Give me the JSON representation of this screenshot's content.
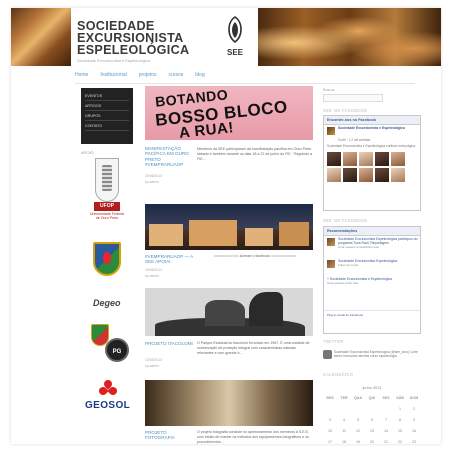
{
  "site": {
    "title_lines": [
      "SOCIEDADE",
      "EXCURSIONISTA",
      "ESPELEOLÓGICA"
    ],
    "tagline": "Sociedade Excursionista e Espeleológica",
    "logo_text": "SEE"
  },
  "nav": [
    "Home",
    "Institucional",
    "projetos",
    "cursos",
    "blog"
  ],
  "left_menu": [
    "EVENTOS",
    "ARTIGOS",
    "GRUPOS",
    "CONTATO"
  ],
  "apoio_label": "APOIO",
  "partners": {
    "ufop_tag": "UFOP",
    "ufop_name_1": "Universidade Federal",
    "ufop_name_2": "de Ouro Preto",
    "degeo": "Degeo",
    "pg": "PG",
    "geosol": "GEOSOL"
  },
  "graffiti": [
    "BOTANDO",
    "BOSSO BLOCO",
    "A RUA!"
  ],
  "posts": [
    {
      "title": "MANIFESTAÇÃO PACÍFICA EM OURO PRETO #VEMPRARUAOP",
      "date": "20/06/2013",
      "author": "by admin",
      "excerpt": "Membros da SEE participaram da manifestação pacífica em Ouro Preto sábado e também durante os dias 18 a 22 de junho do FIE. \"Seguindo a FIE..."
    },
    {
      "title": "#VEMPRARUAOP — A SEE APOIA!",
      "date": "19/06/2013",
      "author": "by admin",
      "excerpt": "============ Acesse o facebook ============"
    },
    {
      "title": "PROJETO ITACOLOMI",
      "date": "13/05/2013",
      "author": "by admin",
      "excerpt": "O Parque Estadual do Itacolomi foi criado em 1967. É uma unidade de conservação de proteção integral com características naturais relevantes e com grande b..."
    },
    {
      "title": "PROJETO FOTOGRAFIA",
      "date": "06/05/2013",
      "author": "by admin",
      "excerpt": "O projeto fotografia consiste no aprimoramento dos membros à S.E.E. com intuito de manter os métodos dos equipamentos fotográficos e os procedimentos..."
    }
  ],
  "sidebar": {
    "search_label": "Buscar",
    "search_placeholder": "",
    "head_facebook": "SEE NO FACEBOOK",
    "fb_title": "Encontre-nos no Facebook",
    "fb_page": "Sociedade Excursionista e Espeleológica",
    "fb_like": "Curtir · 1.2 mil curtidas",
    "fb_text": "Sociedade Excursionista e Espeleológica curtiram esta página.",
    "head_facebook2": "SEE NO FACEBOOK",
    "rec_title": "Recomendações",
    "rec_items": [
      {
        "title": "Sociedade Excursionista Espeleológica participou do programa Toca Raul, Reportagem",
        "sub": "Uma pessoa compartilhou isso."
      },
      {
        "title": "Sociedade Excursionista Espeleológica",
        "sub": "Fotos do mural"
      },
      {
        "title": "+ Sociedade Excursionista e Espeleológica",
        "sub": "Uma pessoa curtiu isso."
      }
    ],
    "fb_plugin": "Plug-in social do Facebook",
    "head_twitter": "TWITTER",
    "tweet": "Sociedade Excursionista Espeleológica (@see_ouro) Corte tweet: Inscrições abertas curso espeleologia",
    "head_calendar": "CALENDÁRIO",
    "calendar_month": "junho 2013",
    "calendar_days": [
      "SEG",
      "TER",
      "QUA",
      "QUI",
      "SEX",
      "SÁB",
      "DOM"
    ],
    "calendar_rows": [
      [
        "",
        "",
        "",
        "",
        "",
        "1",
        "2"
      ],
      [
        "3",
        "4",
        "5",
        "6",
        "7",
        "8",
        "9"
      ],
      [
        "10",
        "11",
        "12",
        "13",
        "14",
        "15",
        "16"
      ],
      [
        "17",
        "18",
        "19",
        "20",
        "21",
        "22",
        "23"
      ],
      [
        "24",
        "25",
        "26",
        "27",
        "28",
        "29",
        "30"
      ]
    ]
  }
}
